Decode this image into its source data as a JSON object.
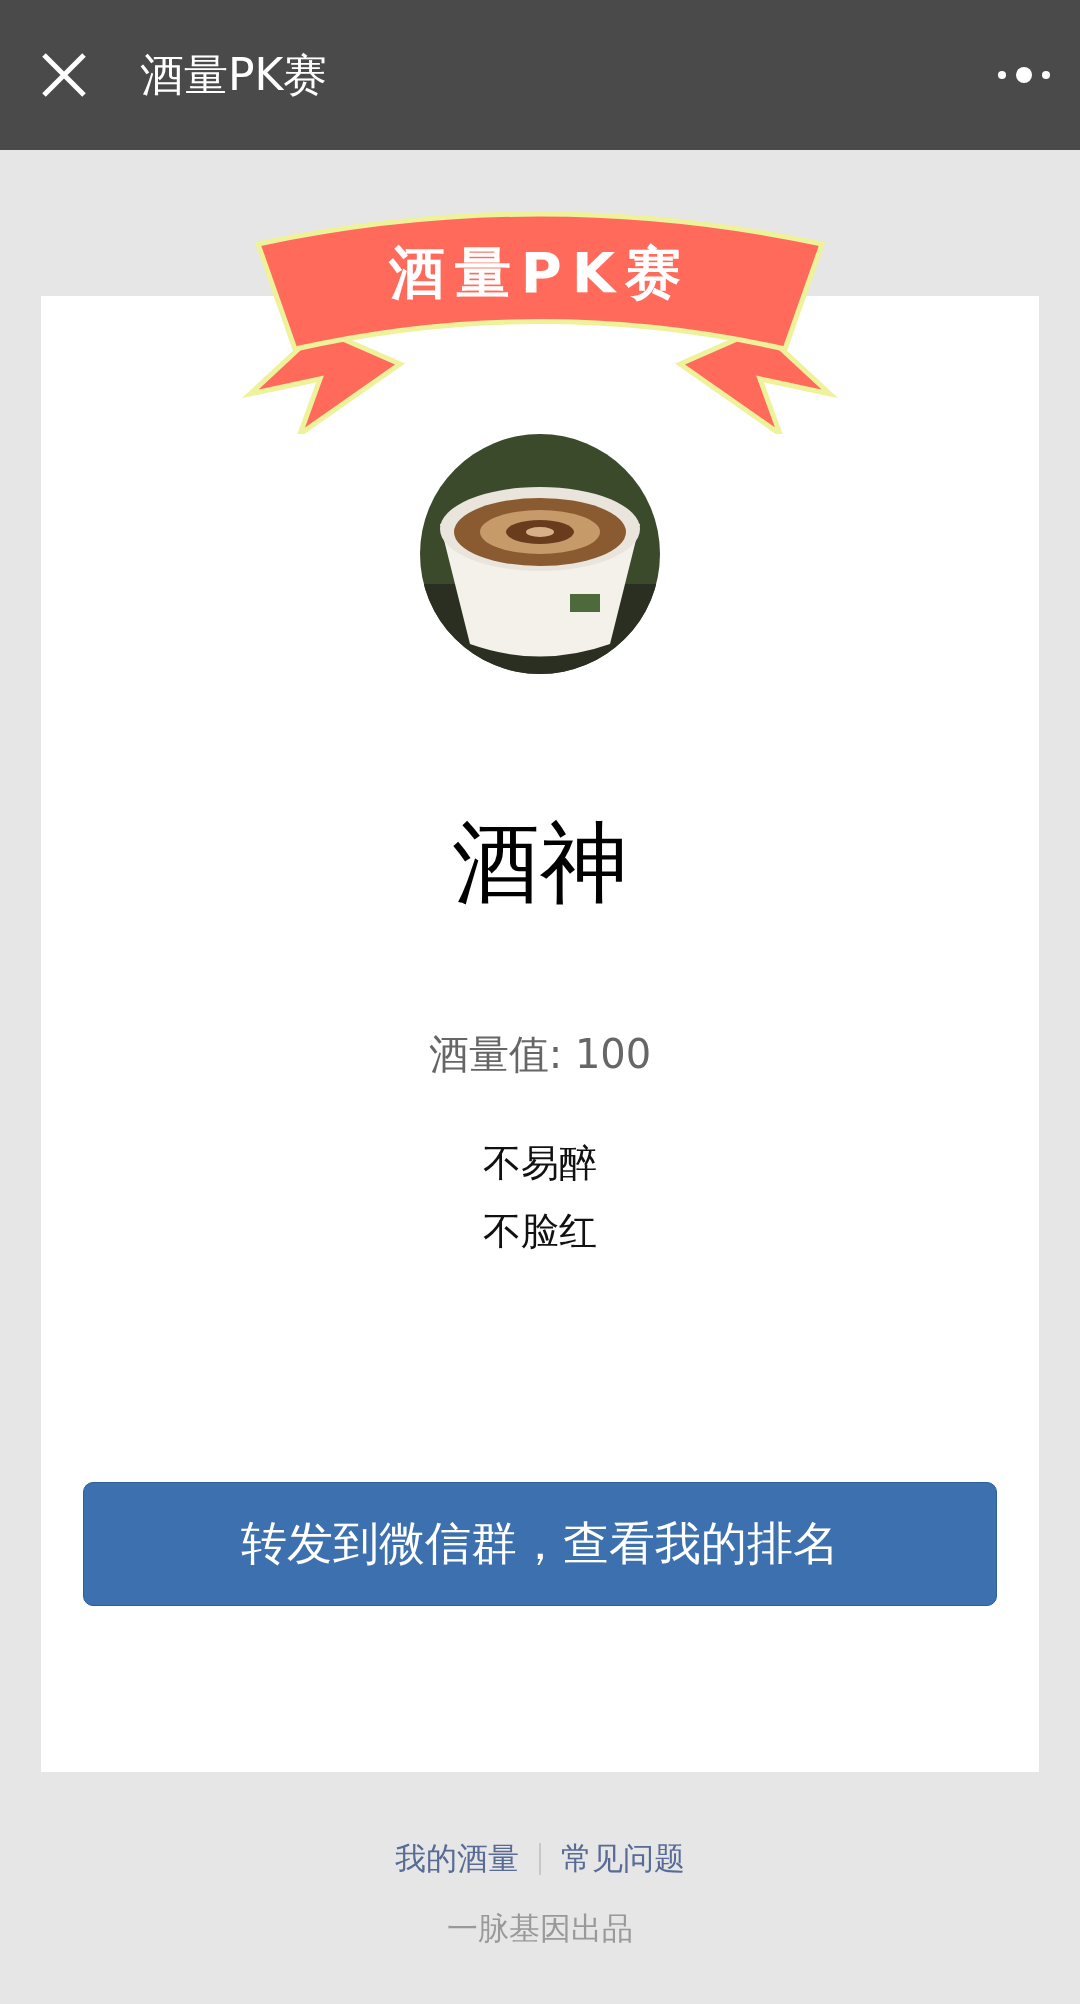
{
  "header": {
    "title": "酒量PK赛"
  },
  "banner": {
    "title": "酒量PK赛"
  },
  "result": {
    "title": "酒神",
    "score": "酒量值: 100",
    "traits": [
      "不易醉",
      "不脸红"
    ]
  },
  "share_button": {
    "label": "转发到微信群，查看我的排名"
  },
  "footer": {
    "links": [
      "我的酒量",
      "常见问题"
    ],
    "credit": "一脉基因出品"
  }
}
